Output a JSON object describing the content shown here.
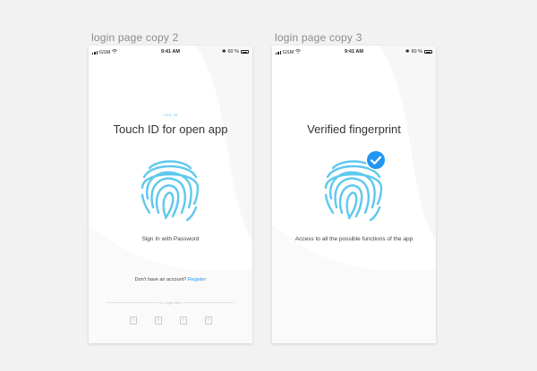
{
  "artboards": [
    {
      "label": "login page copy 2",
      "status": {
        "carrier": "GSM",
        "time": "9:41 AM",
        "battery": "60 %"
      },
      "accent_text": "LOG IN",
      "title": "Touch ID for open app",
      "caption": "Sign In with Password",
      "account_prompt": "Don't have an account?",
      "register_link": "Register",
      "or_text": "Or Login With",
      "social_icons": [
        "?",
        "?",
        "?",
        "?"
      ]
    },
    {
      "label": "login page copy 3",
      "status": {
        "carrier": "GSM",
        "time": "9:41 AM",
        "battery": "60 %"
      },
      "title": "Verified fingerprint",
      "caption": "Access to all the possible functions of the app"
    }
  ],
  "colors": {
    "accent": "#4fc3f7",
    "fingerprint": "#5ec8ee",
    "check_badge": "#2196f3",
    "link": "#2196f3"
  },
  "icons": [
    "fingerprint-icon",
    "check-badge-icon",
    "wifi-icon",
    "bluetooth-icon",
    "battery-icon"
  ]
}
